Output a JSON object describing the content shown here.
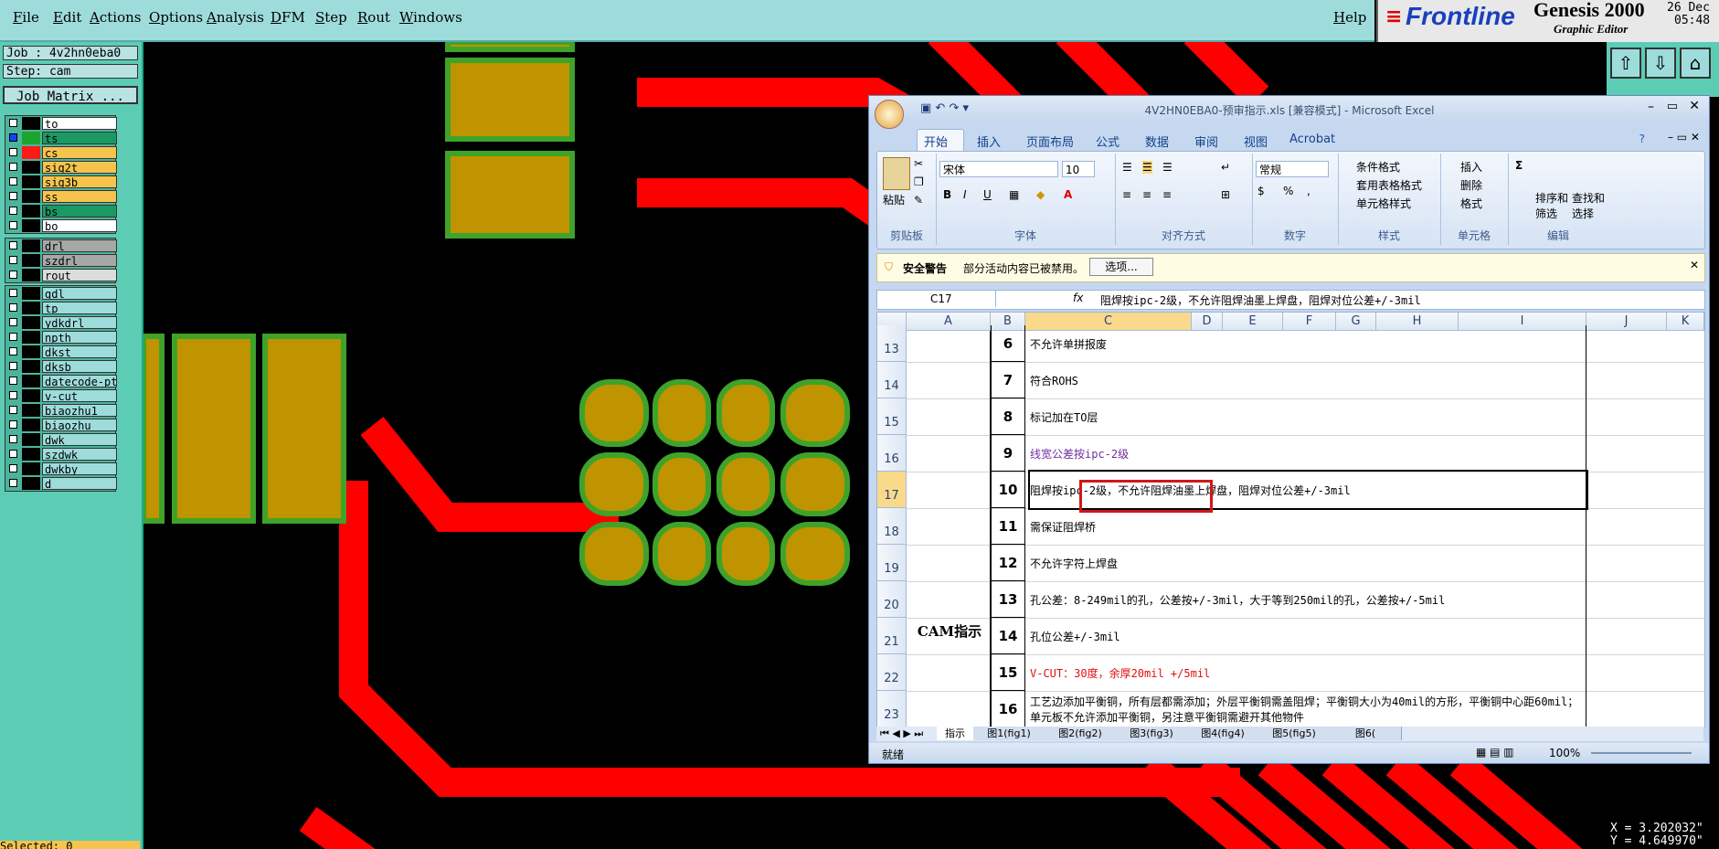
{
  "genesis": {
    "menu": [
      "File",
      "Edit",
      "Actions",
      "Options",
      "Analysis",
      "DFM",
      "Step",
      "Rout",
      "Windows"
    ],
    "help": "Help",
    "brand": "Frontline",
    "product": "Genesis 2000",
    "subtitle": "Graphic Editor",
    "date": "26 Dec",
    "time": "05:48",
    "job_line": "Job : 4v2hn0eba0",
    "step_line": "Step: cam",
    "job_matrix_button": "Job Matrix ...",
    "layer_groups": [
      [
        {
          "name": "to",
          "swatch": "#000000",
          "bg": "#ffffff",
          "checked": false
        },
        {
          "name": "ts",
          "swatch": "#1ca52c",
          "bg": "#1a9a62",
          "checked": true
        },
        {
          "name": "cs",
          "swatch": "#ff1a1a",
          "bg": "#f6c44c",
          "checked": false
        },
        {
          "name": "sig2t",
          "swatch": "#000000",
          "bg": "#f6c44c",
          "checked": false
        },
        {
          "name": "sig3b",
          "swatch": "#000000",
          "bg": "#f6c44c",
          "checked": false
        },
        {
          "name": "ss",
          "swatch": "#000000",
          "bg": "#f6c44c",
          "checked": false
        },
        {
          "name": "bs",
          "swatch": "#000000",
          "bg": "#1a9a62",
          "checked": false
        },
        {
          "name": "bo",
          "swatch": "#000000",
          "bg": "#ffffff",
          "checked": false
        }
      ],
      [
        {
          "name": "drl",
          "swatch": "#000000",
          "bg": "#a7a7a7",
          "checked": false
        },
        {
          "name": "szdrl",
          "swatch": "#000000",
          "bg": "#a7a7a7",
          "checked": false
        },
        {
          "name": "rout",
          "swatch": "#000000",
          "bg": "#dcdcdc",
          "checked": false
        }
      ],
      [
        {
          "name": "gdl",
          "swatch": "#000000",
          "bg": "#9edcdc",
          "checked": false
        },
        {
          "name": "tp",
          "swatch": "#000000",
          "bg": "#9edcdc",
          "checked": false
        },
        {
          "name": "ydkdrl",
          "swatch": "#000000",
          "bg": "#9edcdc",
          "checked": false
        },
        {
          "name": "npth",
          "swatch": "#000000",
          "bg": "#9edcdc",
          "checked": false
        },
        {
          "name": "dkst",
          "swatch": "#000000",
          "bg": "#9edcdc",
          "checked": false
        },
        {
          "name": "dksb",
          "swatch": "#000000",
          "bg": "#9edcdc",
          "checked": false
        },
        {
          "name": "datecode-pt",
          "swatch": "#000000",
          "bg": "#9edcdc",
          "checked": false
        },
        {
          "name": "v-cut",
          "swatch": "#000000",
          "bg": "#9edcdc",
          "checked": false
        },
        {
          "name": "biaozhu1",
          "swatch": "#000000",
          "bg": "#9edcdc",
          "checked": false
        },
        {
          "name": "biaozhu",
          "swatch": "#000000",
          "bg": "#9edcdc",
          "checked": false
        },
        {
          "name": "dwk",
          "swatch": "#000000",
          "bg": "#9edcdc",
          "checked": false
        },
        {
          "name": "szdwk",
          "swatch": "#000000",
          "bg": "#9edcdc",
          "checked": false
        },
        {
          "name": "dwkby",
          "swatch": "#000000",
          "bg": "#9edcdc",
          "checked": false
        },
        {
          "name": "d",
          "swatch": "#000000",
          "bg": "#9edcdc",
          "checked": false
        }
      ]
    ],
    "coord_x": "X = 3.202032\"",
    "coord_y": "Y = 4.649970\"",
    "bottom_left": "Selected: 0"
  },
  "excel": {
    "title": "4V2HN0EBA0-预审指示.xls  [兼容模式] - Microsoft Excel",
    "tabs": [
      "开始",
      "插入",
      "页面布局",
      "公式",
      "数据",
      "审阅",
      "视图",
      "Acrobat"
    ],
    "groups": {
      "clipboard": "剪贴板",
      "font": "字体",
      "alignment": "对齐方式",
      "number": "数字",
      "styles": "样式",
      "cells": "单元格",
      "editing": "编辑"
    },
    "paste": "粘贴",
    "font_name": "宋体",
    "font_size": "10",
    "number_format": "常规",
    "styles_items": [
      "条件格式",
      "套用表格格式",
      "单元格样式"
    ],
    "cells_items": [
      "插入",
      "删除",
      "格式"
    ],
    "editing_items": [
      "排序和筛选",
      "查找和选择"
    ],
    "security_label": "安全警告",
    "security_text": "部分活动内容已被禁用。",
    "options_button": "选项...",
    "name_box": "C17",
    "fx": "fx",
    "formula": "阻焊按ipc-2级，不允许阻焊油墨上焊盘，阻焊对位公差+/-3mil",
    "columns": [
      "A",
      "B",
      "C",
      "D",
      "E",
      "F",
      "G",
      "H",
      "I",
      "J",
      "K"
    ],
    "group_label": "CAM指示",
    "rows": [
      {
        "row": "13",
        "num": "6",
        "text": "不允许单拼报废",
        "color": "#000000"
      },
      {
        "row": "14",
        "num": "7",
        "text": "符合ROHS",
        "color": "#000000"
      },
      {
        "row": "15",
        "num": "8",
        "text": "标记加在TO层",
        "color": "#000000"
      },
      {
        "row": "16",
        "num": "9",
        "text": "线宽公差按ipc-2级",
        "color": "#7030a0"
      },
      {
        "row": "17",
        "num": "10",
        "text": "阻焊按ipc-2级，不允许阻焊油墨上焊盘，阻焊对位公差+/-3mil",
        "color": "#000000"
      },
      {
        "row": "18",
        "num": "11",
        "text": "需保证阻焊桥",
        "color": "#000000"
      },
      {
        "row": "19",
        "num": "12",
        "text": "不允许字符上焊盘",
        "color": "#000000"
      },
      {
        "row": "20",
        "num": "13",
        "text": "孔公差：8-249mil的孔，公差按+/-3mil，大于等到250mil的孔，公差按+/-5mil",
        "color": "#000000"
      },
      {
        "row": "21",
        "num": "14",
        "text": "孔位公差+/-3mil",
        "color": "#000000"
      },
      {
        "row": "22",
        "num": "15",
        "text": "V-CUT：30度，余厚20mil +/5mil",
        "color": "#e01010"
      },
      {
        "row": "23",
        "num": "16",
        "text": "工艺边添加平衡铜，所有层都需添加；外层平衡铜需盖阻焊；平衡铜大小为40mil的方形，平衡铜中心距60mil；单元板不允许添加平衡铜，另注意平衡铜需避开其他物件",
        "color": "#000000"
      }
    ],
    "sheet_tabs": [
      "指示",
      "图1(fig1)",
      "图2(fig2)",
      "图3(fig3)",
      "图4(fig4)",
      "图5(fig5)",
      "图6("
    ],
    "status": "就绪",
    "zoom": "100%"
  }
}
